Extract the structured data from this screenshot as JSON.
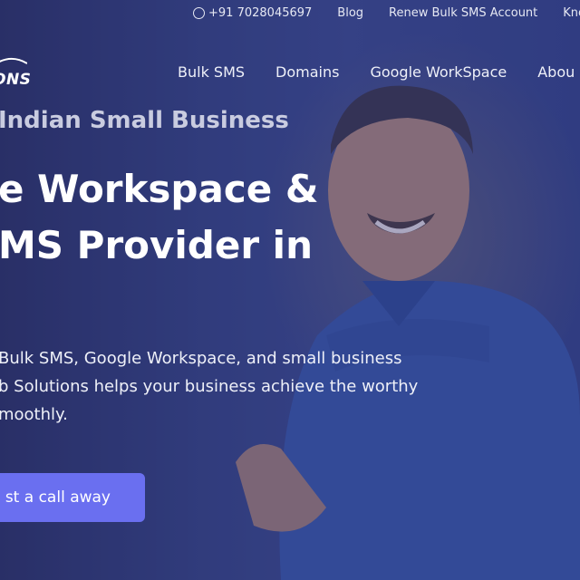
{
  "topbar": {
    "phone": "+91 7028045697",
    "blog": "Blog",
    "renew": "Renew Bulk SMS Account",
    "know": "Kno"
  },
  "logo": {
    "text": "ONS"
  },
  "nav": {
    "items": [
      {
        "label": "Bulk SMS"
      },
      {
        "label": "Domains"
      },
      {
        "label": "Google WorkSpace"
      },
      {
        "label": "Abou"
      }
    ]
  },
  "hero": {
    "eyebrow": "Indian Small Business",
    "headline_line1": "e Workspace &",
    "headline_line2": "MS Provider in",
    "desc_line1": "Bulk SMS, Google Workspace, and small business",
    "desc_line2": "b Solutions helps your business achieve the worthy",
    "desc_line3": "moothly.",
    "cta_label": "st a call away"
  },
  "colors": {
    "cta": "#6a6ff0",
    "overlay": "#2f3d7a"
  }
}
